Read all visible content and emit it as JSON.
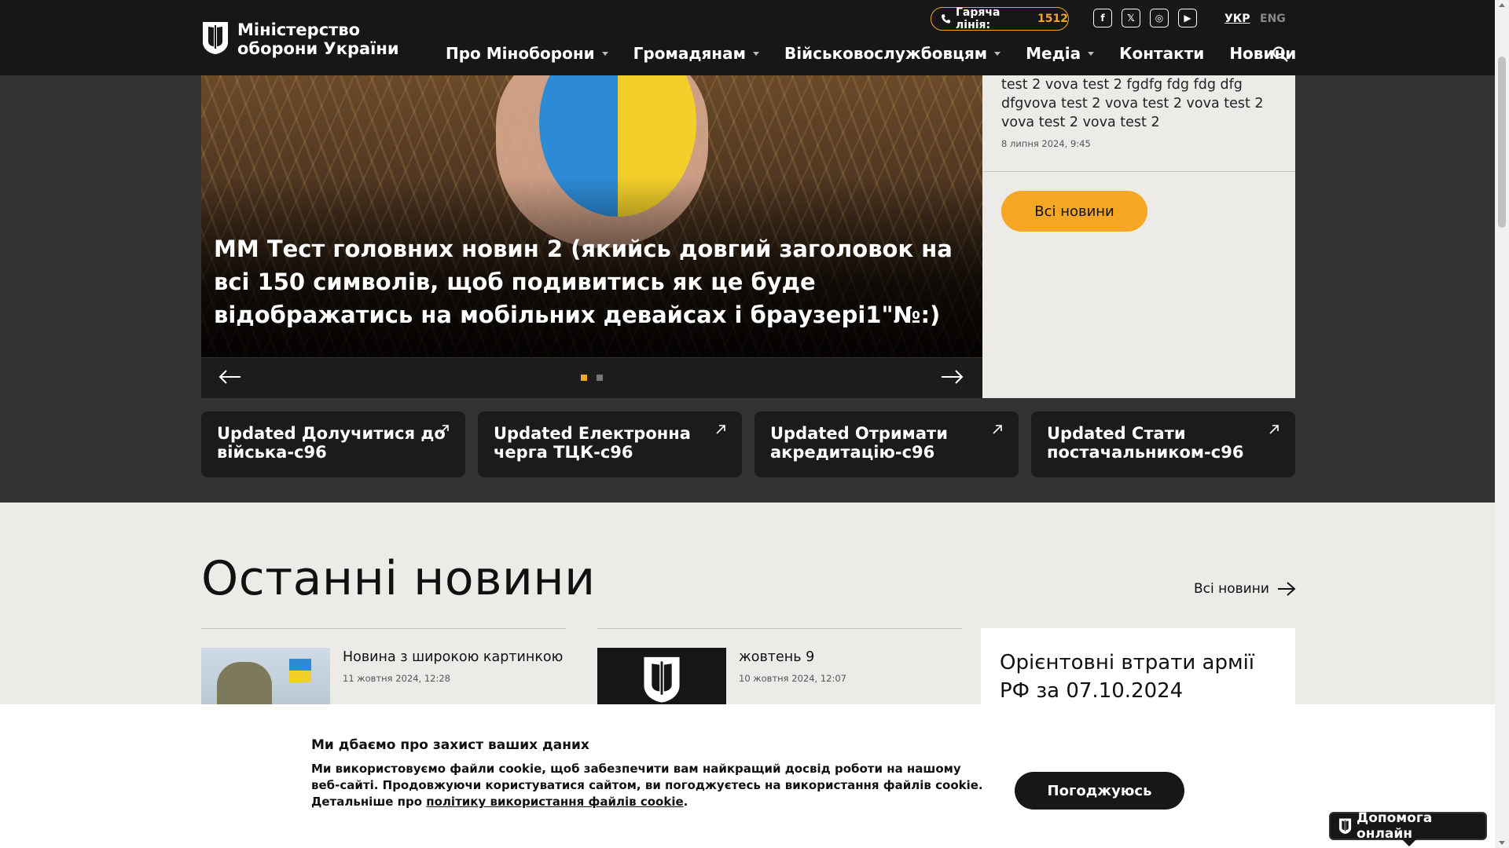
{
  "header": {
    "logo_line1": "Міністерство",
    "logo_line2": "оборони України",
    "hotline_label": "Гаряча лінія:",
    "hotline_number": "1512",
    "socials": [
      "f",
      "𝕏",
      "◎",
      "▶"
    ],
    "lang_ukr": "УКР",
    "lang_eng": "ENG",
    "nav": [
      {
        "label": "Про Міноборони",
        "dropdown": true
      },
      {
        "label": "Громадянам",
        "dropdown": true
      },
      {
        "label": "Військовослужбовцям",
        "dropdown": true
      },
      {
        "label": "Медіа",
        "dropdown": true
      },
      {
        "label": "Контакти",
        "dropdown": false
      },
      {
        "label": "Новини",
        "dropdown": false
      }
    ]
  },
  "hero": {
    "title": "ММ Тест головних новин 2 (якийсь довгий заголовок на всі 150 символів, щоб подивитись як це буде відображатись на мобільних девайсах і браузері1\"№:)",
    "slides_total": 2,
    "slide_active": 1
  },
  "news_side": {
    "text": "test 2 vova test 2 fgdfg fdg fdg dfg dfgvova test 2 vova test 2 vova test 2 vova test 2 vova test 2",
    "date": "8 липня 2024, 9:45",
    "all_news_label": "Всі новини"
  },
  "quick_links": [
    {
      "label": "Updated Долучитися до війська-c96"
    },
    {
      "label": "Updated Електронна черга ТЦК-c96"
    },
    {
      "label": "Updated Отримати акредитацію-c96"
    },
    {
      "label": "Updated Стати постачальником-c96"
    }
  ],
  "latest": {
    "title": "Останні новини",
    "all_label": "Всі новини",
    "items": [
      {
        "title": "Новина з широкою картинкою",
        "date": "11 жовтня 2024, 12:28"
      },
      {
        "title": "жовтень 9",
        "date": "10 жовтня 2024, 12:07"
      }
    ],
    "losses_title": "Орієнтовні втрати армії РФ за 07.10.2024"
  },
  "cookie": {
    "title": "Ми дбаємо про захист ваших даних",
    "text": "Ми використовуємо файли cookie, щоб забезпечити вам найкращий досвід роботи на нашому веб-сайті. Продовжуючи користуватися сайтом, ви погоджуєтесь на використання файлів cookie. Детальніше про ",
    "link": "політику використання файлів cookie",
    "tail": ".",
    "agree_label": "Погоджуюсь"
  },
  "help": {
    "label": "Допомога онлайн"
  },
  "colors": {
    "accent": "#f5a623",
    "header_bg": "#171717",
    "section_bg": "#ecebe7"
  }
}
